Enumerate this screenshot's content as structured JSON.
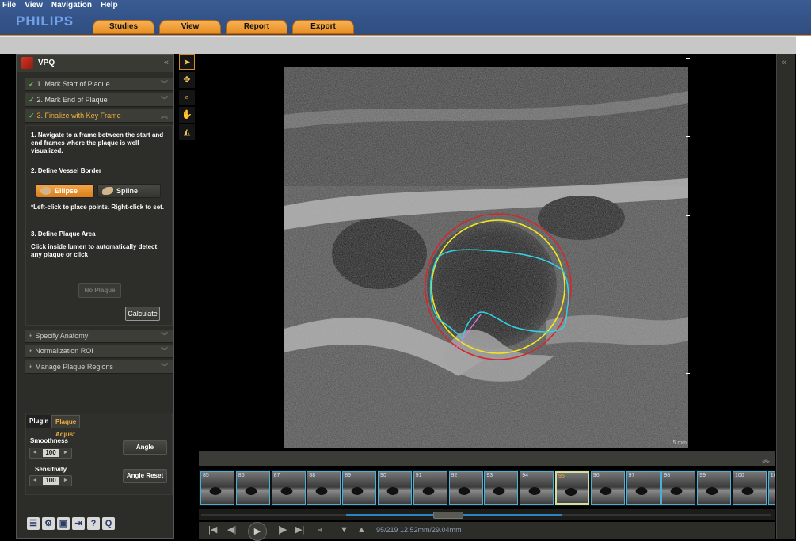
{
  "menu": [
    "File",
    "View",
    "Navigation",
    "Help"
  ],
  "brand": "PHILIPS",
  "tabs": [
    "Studies",
    "View",
    "Report",
    "Export"
  ],
  "panel": {
    "title": "VPQ",
    "steps": [
      {
        "label": "1. Mark Start of Plaque",
        "done": true
      },
      {
        "label": "2. Mark End of Plaque",
        "done": true
      },
      {
        "label": "3. Finalize with Key Frame",
        "done": true,
        "active": true
      }
    ],
    "step3": {
      "intro": "1. Navigate to a frame between the start and end frames where the plaque is well visualized.",
      "define_border": "2. Define Vessel Border",
      "ellipse_label": "Ellipse",
      "spline_label": "Spline",
      "hint": "*Left-click to place points. Right-click to set.",
      "define_area": "3. Define Plaque Area",
      "area_desc": "Click inside lumen to automatically detect any plaque or click",
      "no_plaque_label": "No Plaque",
      "calculate_label": "Calculate"
    },
    "sub_steps": [
      "Specify Anatomy",
      "Normalization ROI",
      "Manage Plaque Regions"
    ]
  },
  "plugin": {
    "tab_plugin": "Plugin",
    "tab_adjust": "Plaque Adjust",
    "smoothness_label": "Smoothness",
    "smoothness_value": "100",
    "sensitivity_label": "Sensitivity",
    "sensitivity_value": "100",
    "angle_label": "Angle",
    "angle_reset_label": "Angle Reset"
  },
  "viewer": {
    "scale_label": "5 mm"
  },
  "thumbnails": [
    "85",
    "86",
    "87",
    "88",
    "89",
    "90",
    "91",
    "92",
    "93",
    "94",
    "95",
    "96",
    "97",
    "98",
    "99",
    "100",
    "10"
  ],
  "current_thumbnail": "95",
  "cine": {
    "frame_readout": "95/219  12.52mm/29.04mm",
    "position": 0.43
  },
  "colors": {
    "accent_orange": "#e88f22",
    "header_blue": "#2f4d80",
    "thumb_border": "#4ab0d8",
    "ellipse_outer": "#d6262b",
    "ellipse_inner": "#f5e61a",
    "lumen_trace": "#2fd3e6"
  },
  "icons": [
    "select-arrow-icon",
    "zoom-icon",
    "magnify-icon",
    "pan-hand-icon",
    "measure-icon"
  ]
}
